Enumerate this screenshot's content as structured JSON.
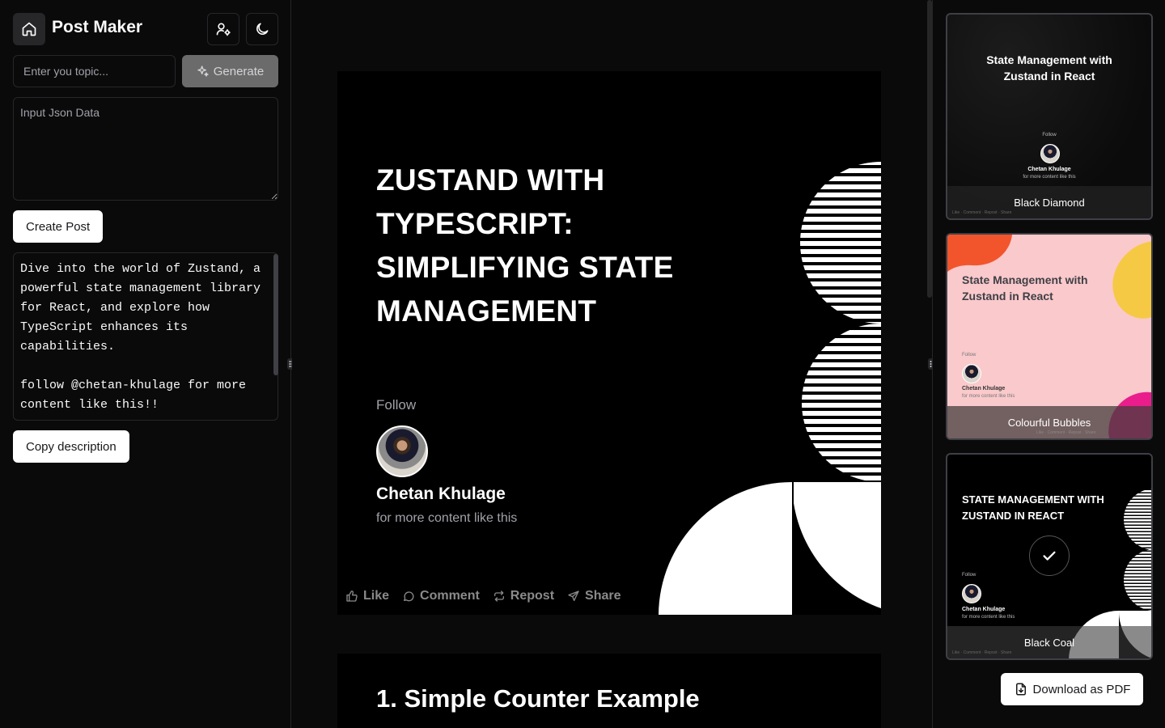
{
  "app": {
    "title": "Post Maker"
  },
  "sidebar": {
    "topic_placeholder": "Enter you topic...",
    "generate_label": "Generate",
    "json_placeholder": "Input Json Data",
    "create_post_label": "Create Post",
    "description": "Dive into the world of Zustand, a\npowerful state management library\nfor React, and explore how\nTypeScript enhances its\ncapabilities.\n\nfollow @chetan-khulage for more\ncontent like this!!",
    "copy_label": "Copy description"
  },
  "slide": {
    "title": "Zustand with TypeScript: Simplifying State Management",
    "follow": "Follow",
    "author_name": "Chetan Khulage",
    "author_sub": "for more content like this",
    "actions": {
      "like": "Like",
      "comment": "Comment",
      "repost": "Repost",
      "share": "Share"
    }
  },
  "slide2": {
    "title": "1. Simple Counter Example"
  },
  "templates": [
    {
      "title": "State Management with Zustand in React",
      "label": "Black Diamond",
      "follow": "Follow",
      "author": "Chetan Khulage",
      "sub": "for more content like this",
      "actions": "Like · Comment · Repost · Share"
    },
    {
      "title": "State Management with Zustand in React",
      "label": "Colourful Bubbles",
      "follow": "Follow",
      "author": "Chetan Khulage",
      "sub": "for more content like this",
      "actions": "Like · Comment · Repost · Share"
    },
    {
      "title": "STATE MANAGEMENT WITH ZUSTAND IN REACT",
      "label": "Black Coal",
      "follow": "Follow",
      "author": "Chetan Khulage",
      "sub": "for more content like this",
      "actions": "Like · Comment · Repost · Share",
      "selected": true
    }
  ],
  "download_label": "Download as PDF",
  "colors": {
    "bg": "#0a0a0a",
    "border": "#27272a",
    "muted": "#a1a1aa",
    "bubble_bg": "#f9c9cb",
    "bubble_orange": "#f2552c",
    "bubble_yellow": "#f6c944",
    "bubble_pink": "#e91e8c"
  }
}
